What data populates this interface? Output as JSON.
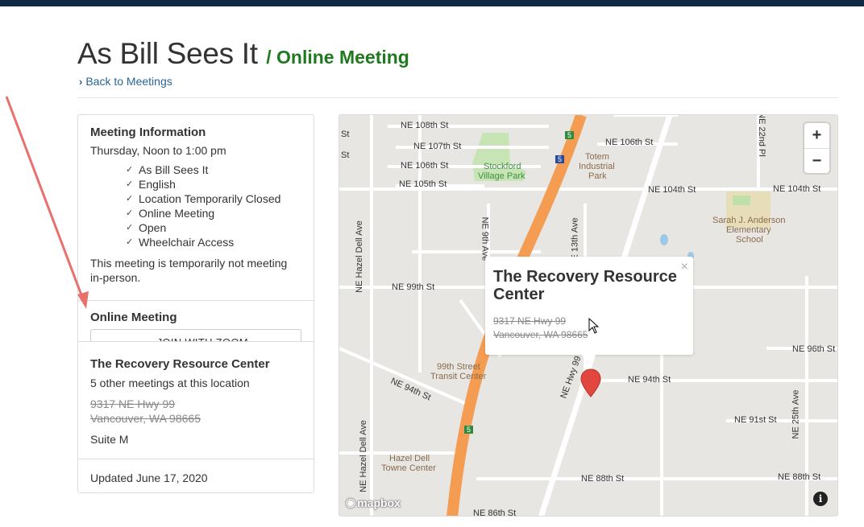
{
  "header": {
    "title": "As Bill Sees It",
    "subtitle": "/ Online Meeting",
    "back_link": "Back to Meetings"
  },
  "meeting_info": {
    "heading": "Meeting Information",
    "time": "Thursday, Noon to 1:00 pm",
    "features": [
      "As Bill Sees It",
      "English",
      "Location Temporarily Closed",
      "Online Meeting",
      "Open",
      "Wheelchair Access"
    ],
    "note": "This meeting is temporarily not meeting in-person."
  },
  "online": {
    "heading": "Online Meeting",
    "join_button": "JOIN WITH ZOOM"
  },
  "location": {
    "name": "The Recovery Resource Center",
    "other_meetings": "5 other meetings at this location",
    "address_line1": "9317 NE Hwy 99",
    "address_line2": "Vancouver, WA 98665",
    "suite": "Suite M"
  },
  "updated": "Updated June 17, 2020",
  "map": {
    "popup": {
      "title": "The Recovery Resource Center",
      "address_line1": "9317 NE Hwy 99",
      "address_line2": "Vancouver, WA 98665",
      "close": "×"
    },
    "zoom_in": "+",
    "zoom_out": "−",
    "attribution": "mapbox",
    "info": "i",
    "labels": {
      "ne108": "NE 108th St",
      "ne107": "NE 107th St",
      "ne106": "NE 106th St",
      "ne105": "NE 105th St",
      "ne106e": "NE 106th St",
      "ne104": "NE 104th St",
      "ne104e": "NE 104th St",
      "ne99": "NE 99th St",
      "ne96": "NE 96th St",
      "ne94": "NE 94th St",
      "ne94e": "NE 94th St",
      "ne91": "NE 91st St",
      "ne88": "NE 88th St",
      "ne88e": "NE 88th St",
      "ne86": "NE 86th St",
      "st1": "St",
      "st2": "St",
      "hazel1": "NE Hazel Dell Ave",
      "hazel2": "NE Hazel Dell Ave",
      "ne9": "NE 9th Ave",
      "ne13": "NE 13th Ave",
      "ne22": "NE 22nd Pl",
      "ne25": "NE 25th Ave",
      "hwy99": "NE Hwy 99",
      "park1": "Stockford",
      "park2": "Village Park",
      "totem1": "Totem",
      "totem2": "Industrial",
      "totem3": "Park",
      "school1": "Sarah J. Anderson",
      "school2": "Elementary",
      "school3": "School",
      "transit1": "99th Street",
      "transit2": "Transit Center",
      "hazelc1": "Hazel Dell",
      "hazelc2": "Towne Center",
      "shield5a": "5",
      "shield5b": "5",
      "shield5c": "5"
    }
  }
}
